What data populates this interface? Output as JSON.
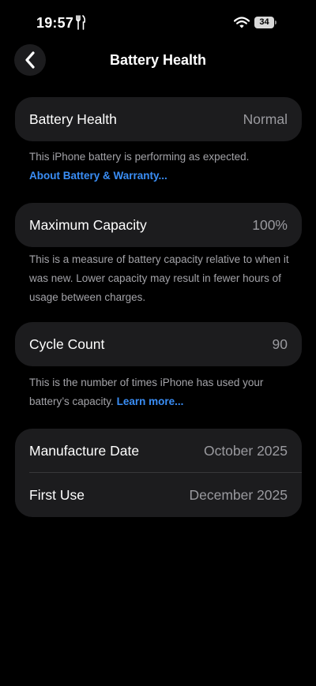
{
  "status_bar": {
    "time": "19:57",
    "battery_level": "34"
  },
  "nav": {
    "title": "Battery Health"
  },
  "battery_health": {
    "label": "Battery Health",
    "value": "Normal",
    "note": "This iPhone battery is performing as expected.",
    "link": "About Battery & Warranty..."
  },
  "maximum_capacity": {
    "label": "Maximum Capacity",
    "value": "100%",
    "note": "This is a measure of battery capacity relative to when it was new. Lower capacity may result in fewer hours of usage between charges."
  },
  "cycle_count": {
    "label": "Cycle Count",
    "value": "90",
    "note": "This is the number of times iPhone has used your battery’s capacity.",
    "link": "Learn more..."
  },
  "dates": {
    "manufacture_label": "Manufacture Date",
    "manufacture_value": "October 2025",
    "first_use_label": "First Use",
    "first_use_value": "December 2025"
  },
  "colors": {
    "background": "#000000",
    "card": "#1c1c1e",
    "link": "#3a8ef6",
    "secondary_text": "#9a9a9f"
  },
  "icons": [
    "fork-knife-icon",
    "wifi-icon",
    "battery-icon",
    "chevron-left-icon"
  ]
}
